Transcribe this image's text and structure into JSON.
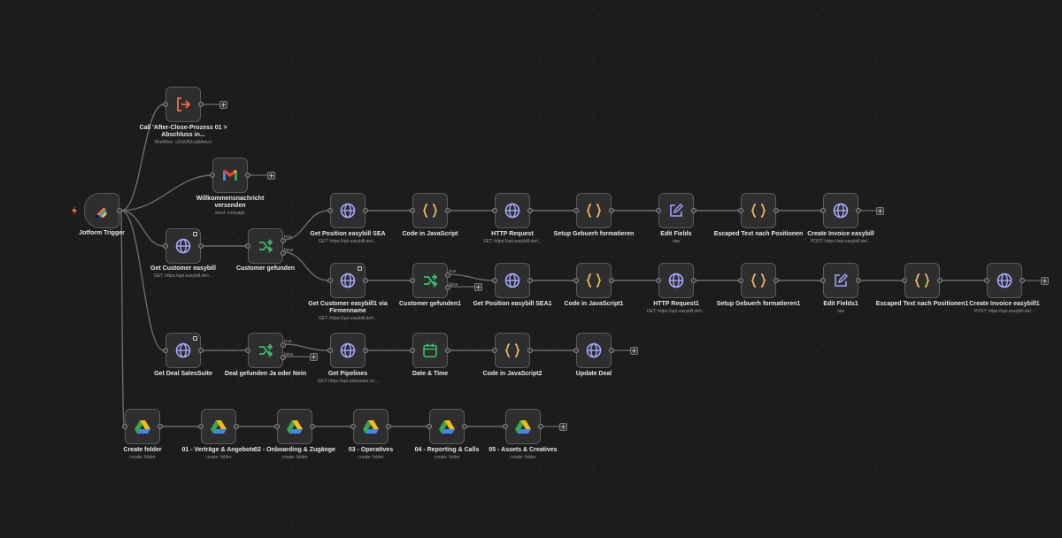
{
  "colors": {
    "canvas": "#1c1c1c",
    "node": "#2e2e2e",
    "border": "#5b5b5b",
    "http": "#a8a9ff",
    "code": "#f5b95a",
    "if": "#35c26a",
    "set": "#9fa0ff",
    "exec": "#ff6d3b",
    "trigger": "#ff5c2c"
  },
  "nodes": {
    "trigger": {
      "title": "Jotform Trigger",
      "icon": "jotform-icon"
    },
    "call": {
      "title": "Call 'After-Close-Prozess 01 > Abschluss in...",
      "subtitle": "Workflow: v3JzUN1sq8Awiz1"
    },
    "welcome": {
      "title": "Willkommensnachricht versenden",
      "subtitle": "send: message"
    },
    "get_customer": {
      "title": "Get Customer easybill",
      "subtitle": "GET: https://api.easybill.de/r..."
    },
    "customer_found": {
      "title": "Customer gefunden"
    },
    "get_pos_sea": {
      "title": "Get Position easybill SEA",
      "subtitle": "GET: https://api.easybill.de/r..."
    },
    "code_js": {
      "title": "Code in JavaScript"
    },
    "http_req": {
      "title": "HTTP Request",
      "subtitle": "GET: https://api.easybill.de/r..."
    },
    "setup_gebuehr": {
      "title": "Setup Gebuerh formatieren"
    },
    "edit_fields": {
      "title": "Edit Fields",
      "subtitle": "raw"
    },
    "escaped_text": {
      "title": "Escaped Text nach Positionen"
    },
    "create_invoice": {
      "title": "Create Invoice easybill",
      "subtitle": "POST: https://api.easybill.de/..."
    },
    "get_customer1": {
      "title": "Get Customer easybill1 via Firmenname",
      "subtitle": "GET: https://api.easybill.de/r..."
    },
    "customer_found1": {
      "title": "Customer gefunden1"
    },
    "get_pos_sea1": {
      "title": "Get Position easybill SEA1"
    },
    "code_js1": {
      "title": "Code in JavaScript1"
    },
    "http_req1": {
      "title": "HTTP Request1",
      "subtitle": "GET: https://api.easybill.de/r..."
    },
    "setup_gebuehr1": {
      "title": "Setup Gebuerh formatieren1"
    },
    "edit_fields1": {
      "title": "Edit Fields1",
      "subtitle": "raw"
    },
    "escaped_text1": {
      "title": "Escaped Text nach Positionen1"
    },
    "create_invoice1": {
      "title": "Create Invoice easybill1",
      "subtitle": "POST: https://api.easybill.de/..."
    },
    "get_deal": {
      "title": "Get Deal SalesSuite"
    },
    "deal_found": {
      "title": "Deal gefunden Ja oder Nein"
    },
    "get_pipelines": {
      "title": "Get Pipelines",
      "subtitle": "GET: https://api.salessuite.co..."
    },
    "date_time": {
      "title": "Date & Time"
    },
    "code_js2": {
      "title": "Code in JavaScript2"
    },
    "update_deal": {
      "title": "Update Deal"
    },
    "create_folder": {
      "title": "Create folder",
      "subtitle": "create: folder"
    },
    "folder_01": {
      "title": "01 - Verträge & Angebote",
      "subtitle": "create: folder"
    },
    "folder_02": {
      "title": "02 - Onboarding & Zugänge",
      "subtitle": "create: folder"
    },
    "folder_03": {
      "title": "03 - Operatives",
      "subtitle": "create: folder"
    },
    "folder_04": {
      "title": "04 - Reporting & Calls",
      "subtitle": "create: folder"
    },
    "folder_05": {
      "title": "05 - Assets & Creatives",
      "subtitle": "create: folder"
    }
  },
  "branch": {
    "true_label": "true",
    "false_label": "false"
  },
  "plus_symbol": "+"
}
